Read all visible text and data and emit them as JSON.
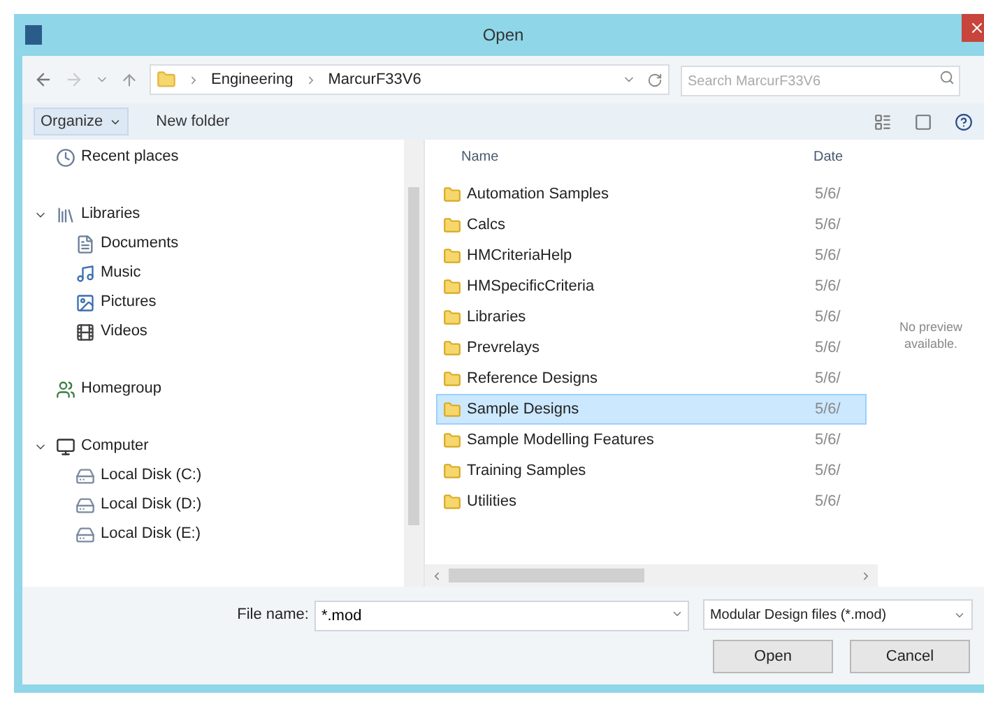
{
  "window": {
    "title": "Open"
  },
  "address_bar": {
    "path": [
      "Engineering",
      "MarcurF33V6"
    ],
    "search_placeholder": "Search MarcurF33V6"
  },
  "toolbar": {
    "buttons": [
      "Organize",
      "New folder"
    ]
  },
  "navigation": [
    {
      "label": "Recent places",
      "kind": "recent"
    },
    {
      "label": "Libraries",
      "kind": "libraries",
      "expanded": true,
      "children": [
        {
          "label": "Documents",
          "kind": "documents"
        },
        {
          "label": "Music",
          "kind": "music"
        },
        {
          "label": "Pictures",
          "kind": "pictures"
        },
        {
          "label": "Videos",
          "kind": "videos"
        }
      ]
    },
    {
      "label": "Homegroup",
      "kind": "homegroup"
    },
    {
      "label": "Computer",
      "kind": "computer",
      "expanded": true,
      "children": [
        {
          "label": "Local Disk (C:)",
          "kind": "drive"
        },
        {
          "label": "Local Disk (D:)",
          "kind": "drive"
        },
        {
          "label": "Local Disk (E:)",
          "kind": "drive"
        }
      ]
    }
  ],
  "file_list": {
    "columns": [
      "Name",
      "Date"
    ],
    "rows": [
      {
        "name": "Automation Samples",
        "date": "5/6/",
        "selected": false
      },
      {
        "name": "Calcs",
        "date": "5/6/",
        "selected": false
      },
      {
        "name": "HMCriteriaHelp",
        "date": "5/6/",
        "selected": false
      },
      {
        "name": "HMSpecificCriteria",
        "date": "5/6/",
        "selected": false
      },
      {
        "name": "Libraries",
        "date": "5/6/",
        "selected": false
      },
      {
        "name": "Prevrelays",
        "date": "5/6/",
        "selected": false
      },
      {
        "name": "Reference Designs",
        "date": "5/6/",
        "selected": false
      },
      {
        "name": "Sample Designs",
        "date": "5/6/",
        "selected": true
      },
      {
        "name": "Sample Modelling Features",
        "date": "5/6/",
        "selected": false
      },
      {
        "name": "Training Samples",
        "date": "5/6/",
        "selected": false
      },
      {
        "name": "Utilities",
        "date": "5/6/",
        "selected": false
      }
    ]
  },
  "preview": {
    "message": "No preview available."
  },
  "footer": {
    "file_name_label": "File name:",
    "file_name": "*.mod",
    "file_type": "Modular Design files (*.mod)",
    "buttons": [
      "Open",
      "Cancel"
    ]
  }
}
